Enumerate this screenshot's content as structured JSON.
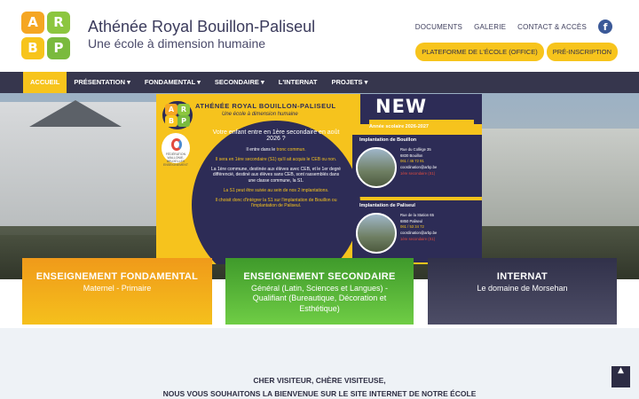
{
  "header": {
    "logo_letters": [
      "A",
      "R",
      "B",
      "P"
    ],
    "logo_colors": [
      "#f5a623",
      "#8cc63f",
      "#f7c41c",
      "#7aba3e"
    ],
    "title": "Athénée Royal Bouillon-Paliseul",
    "subtitle": "Une école à dimension humaine",
    "top_links": [
      "DOCUMENTS",
      "GALERIE",
      "CONTACT & ACCÈS"
    ],
    "facebook_icon": "f",
    "buttons": [
      "PLATEFORME DE L'ÉCOLE (OFFICE)",
      "PRÉ-INSCRIPTION"
    ]
  },
  "nav": {
    "items": [
      "ACCUEIL",
      "PRÉSENTATION ▾",
      "FONDAMENTAL ▾",
      "SECONDAIRE ▾",
      "L'INTERNAT",
      "PROJETS ▾"
    ]
  },
  "flyer": {
    "school": "ATHÉNÉE ROYAL BOUILLON-PALISEUL",
    "tagline": "Une école à dimension humaine",
    "fwb_label": "FÉDÉRATION WALLONIE-BRUXELLES ENSEIGNEMENT",
    "new": "NEW",
    "year": "Année scolaire 2026-2027",
    "lead": "Votre enfant entre en 1ère secondaire en août 2026 ?",
    "p1_a": "Il entre dans le ",
    "p1_hl": "tronc commun.",
    "p2_hl": "Il sera en 1ère secondaire (S1) qu'il ait acquis le CEB ou non.",
    "p3": "La 1ère commune, destinée aux élèves avec CEB, et le 1er degré différencié, destiné aux élèves sans CEB, sont rassemblés dans une classe commune, la S1.",
    "p4_hl": "La S1 peut être suivie au sein de nos 2 implantations.",
    "p5_hl": "Il choisit donc d'intégrer la S1 sur l'implantation de Bouillon ou l'implantation de Paliseul.",
    "bouillon": {
      "title": "Implantation de Bouillon",
      "address1": "Rue du Collège 35",
      "address2": "6830 Bouillon",
      "phone": "061 / 46 72 91",
      "email": "coordination@arbp.be",
      "level": "1ère secondaire (S1)"
    },
    "paliseul": {
      "title": "Implantation de Paliseul",
      "address1": "Rue de la Station 65",
      "address2": "6850 Paliseul",
      "phone": "061 / 53 34 72",
      "email": "coordination@arbp.be",
      "level": "1ère secondaire (S1)"
    }
  },
  "cards": [
    {
      "title": "ENSEIGNEMENT FONDAMENTAL",
      "subtitle": "Maternel - Primaire"
    },
    {
      "title": "ENSEIGNEMENT SECONDAIRE",
      "subtitle": "Général (Latin, Sciences et Langues) - Qualifiant (Bureautique, Décoration et Esthétique)"
    },
    {
      "title": "INTERNAT",
      "subtitle": "Le domaine de Morsehan"
    }
  ],
  "welcome": {
    "line1": "CHER VISITEUR, CHÈRE VISITEUSE,",
    "line2": "NOUS VOUS SOUHAITONS LA BIENVENUE SUR LE SITE INTERNET DE NOTRE ÉCOLE"
  },
  "back_to_top_icon": "▲"
}
